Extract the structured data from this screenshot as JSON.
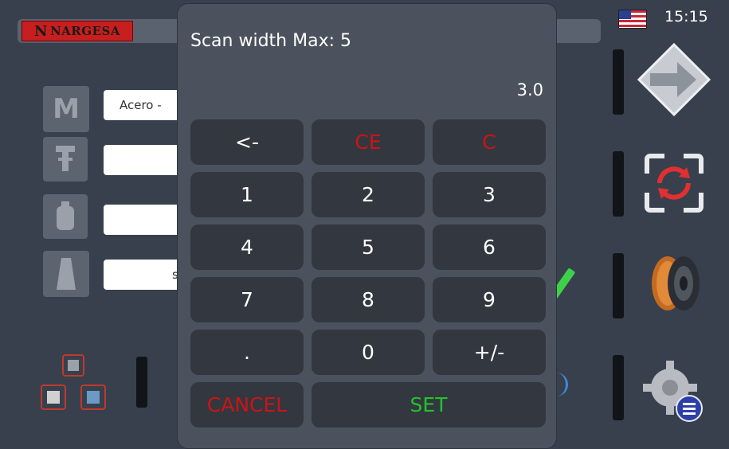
{
  "header": {
    "logo_text": "NARGESA",
    "logo_letter": "N",
    "clock": "15:15",
    "language_flag": "us-flag-icon"
  },
  "background": {
    "material_field": "Acero -",
    "field2_value": "",
    "field3_value": "",
    "field4_partial": "s"
  },
  "dialog": {
    "title": "Scan width Max: 5",
    "display_value": "3.0",
    "keys": [
      {
        "label": "<-",
        "color": "#ffffff"
      },
      {
        "label": "CE",
        "color": "#cc1414"
      },
      {
        "label": "C",
        "color": "#cc1414"
      },
      {
        "label": "1"
      },
      {
        "label": "2"
      },
      {
        "label": "3"
      },
      {
        "label": "4"
      },
      {
        "label": "5"
      },
      {
        "label": "6"
      },
      {
        "label": "7"
      },
      {
        "label": "8"
      },
      {
        "label": "9"
      },
      {
        "label": "."
      },
      {
        "label": "0"
      },
      {
        "label": "+/-"
      },
      {
        "label": "CANCEL",
        "color": "#cc1414"
      },
      {
        "label": "SET",
        "color": "#25c22b"
      }
    ]
  },
  "right_panel": {
    "buttons": [
      "next-arrow-icon",
      "refresh-scan-icon",
      "wire-spool-icon",
      "settings-list-icon"
    ]
  },
  "colors": {
    "background": "#38404d",
    "dialog": "#4b525d",
    "key": "#33373f",
    "danger": "#cc1414",
    "ok": "#25c22b"
  }
}
